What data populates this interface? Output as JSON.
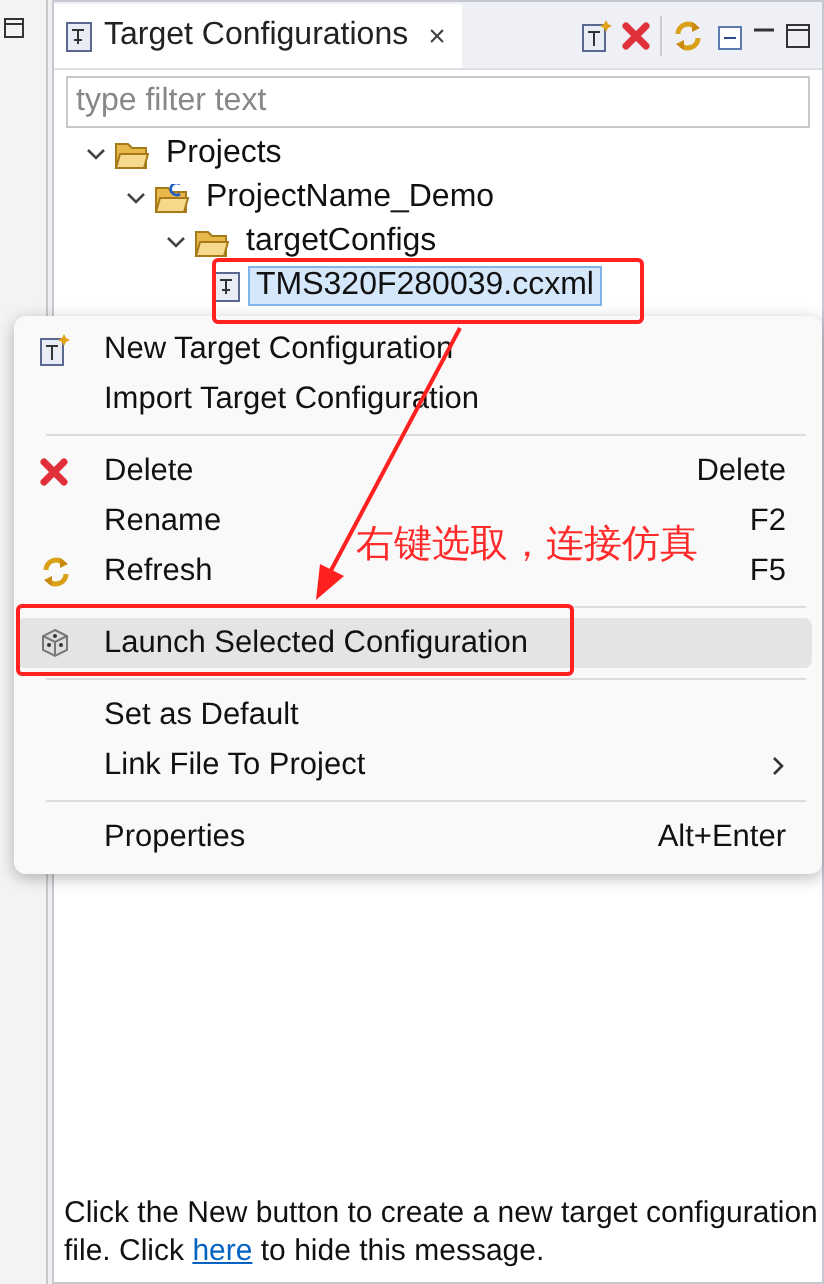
{
  "view": {
    "title": "Target Configurations",
    "close": "×",
    "filter": {
      "placeholder": "type filter text"
    }
  },
  "tree": [
    {
      "label": "Projects",
      "kind": "folder",
      "expanded": true,
      "selected": false,
      "children": [
        {
          "label": "ProjectName_Demo",
          "kind": "project",
          "expanded": true,
          "selected": false,
          "children": [
            {
              "label": "targetConfigs",
              "kind": "folder",
              "expanded": true,
              "selected": false,
              "children": [
                {
                  "label": "TMS320F280039.ccxml",
                  "kind": "file",
                  "selected": true
                }
              ]
            }
          ]
        }
      ]
    }
  ],
  "context_menu": [
    {
      "kind": "item",
      "label": "New Target Configuration",
      "highlighted": false
    },
    {
      "kind": "item",
      "label": "Import Target Configuration",
      "highlighted": false
    },
    {
      "kind": "separator"
    },
    {
      "kind": "item",
      "label": "Delete",
      "shortcut": "Delete",
      "highlighted": false
    },
    {
      "kind": "item",
      "label": "Rename",
      "shortcut": "F2",
      "highlighted": false
    },
    {
      "kind": "item",
      "label": "Refresh",
      "shortcut": "F5",
      "highlighted": false
    },
    {
      "kind": "separator"
    },
    {
      "kind": "item",
      "label": "Launch Selected Configuration",
      "highlighted": true
    },
    {
      "kind": "separator"
    },
    {
      "kind": "item",
      "label": "Set as Default",
      "highlighted": false
    },
    {
      "kind": "item",
      "label": "Link File To Project",
      "submenu": true,
      "highlighted": false
    },
    {
      "kind": "separator"
    },
    {
      "kind": "item",
      "label": "Properties",
      "shortcut": "Alt+Enter",
      "highlighted": false
    }
  ],
  "annotation": {
    "text": "右键选取，连接仿真"
  },
  "message": {
    "before": "Click the New button to create a new target configuration file. Click ",
    "link": "here",
    "after": " to hide this message."
  }
}
